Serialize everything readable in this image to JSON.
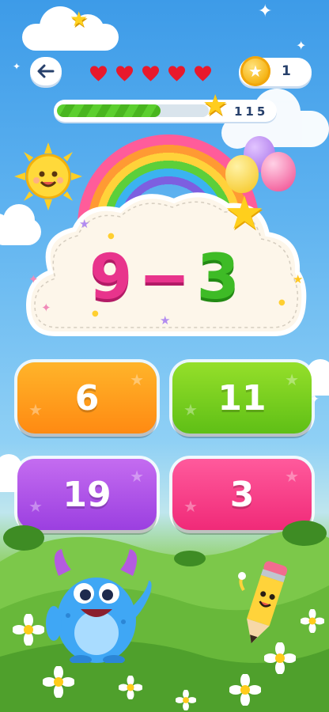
{
  "header": {
    "back_icon": "arrow-left-icon",
    "lives": 5,
    "life_icon": "heart-icon",
    "coins": "1",
    "coin_icon": "star-coin-icon"
  },
  "progress": {
    "fraction": 0.68,
    "score": "115",
    "marker_icon": "star-icon"
  },
  "question": {
    "operand_a": "9",
    "operator": "−",
    "operand_b": "3"
  },
  "answers": [
    {
      "label": "6",
      "color": "#ff9a1f"
    },
    {
      "label": "11",
      "color": "#78d020"
    },
    {
      "label": "19",
      "color": "#b057ea"
    },
    {
      "label": "3",
      "color": "#f5418a"
    }
  ],
  "colors": {
    "sky_top": "#3d9be8",
    "grass": "#5eb33a",
    "heart": "#e8192c",
    "operand_a": "#e8348c",
    "operand_b": "#3ebb26"
  }
}
